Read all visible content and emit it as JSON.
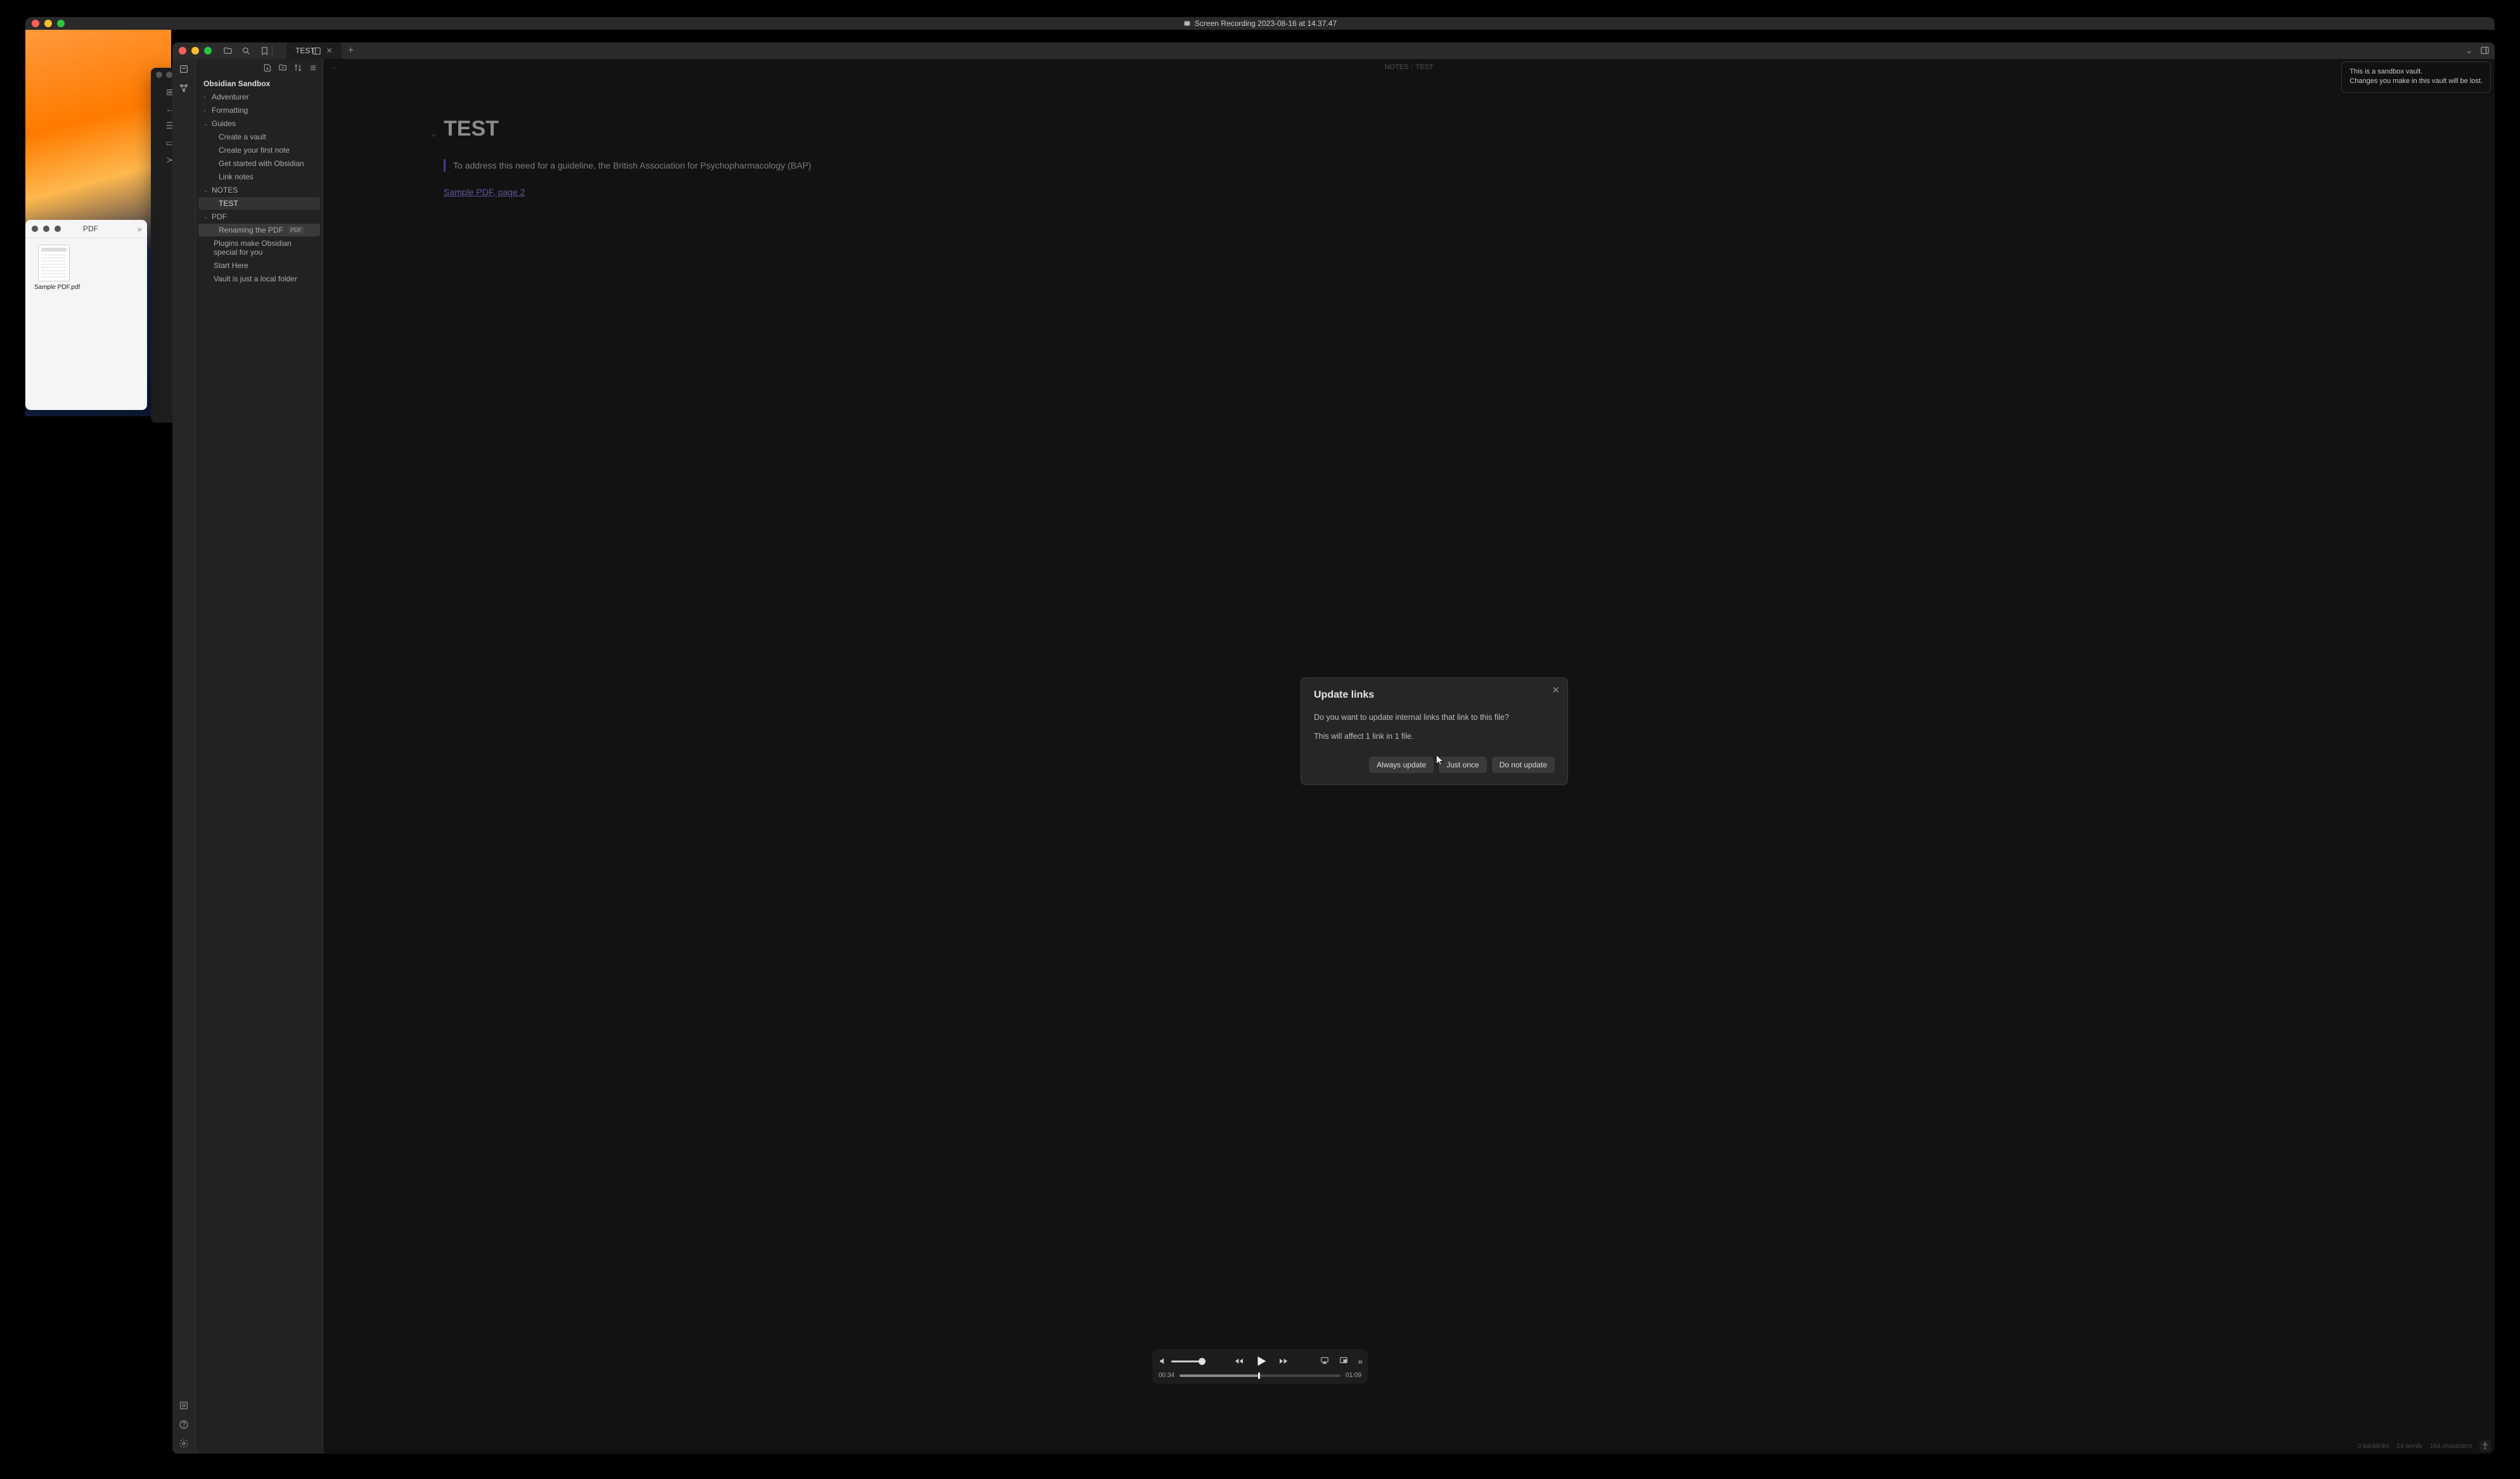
{
  "qt": {
    "title": "Screen Recording 2023-08-16 at 14.37.47",
    "controls": {
      "current": "00:34",
      "total": "01:09",
      "volume_pct": 95,
      "progress_pct": 49
    }
  },
  "finder": {
    "title": "PDF",
    "file": "Sample PDF.pdf"
  },
  "obsidian": {
    "tab": "TEST",
    "vault": "Obsidian Sandbox",
    "toast_l1": "This is a sandbox vault.",
    "toast_l2": "Changes you make in this vault will be lost.",
    "tree": {
      "adventurer": "Adventurer",
      "formatting": "Formatting",
      "guides": "Guides",
      "g1": "Create a vault",
      "g2": "Create your first note",
      "g3": "Get started with Obsidian",
      "g4": "Link notes",
      "notes": "NOTES",
      "n1": "TEST",
      "pdf": "PDF",
      "p1": "Renaming the PDF",
      "p1_badge": "PDF",
      "plugins": "Plugins make Obsidian special for you",
      "start": "Start Here",
      "vaultnote": "Vault is just a local folder"
    },
    "crumbs": {
      "a": "NOTES",
      "b": "TEST"
    },
    "note": {
      "title": "TEST",
      "quote": "To address this need for a guideline, the British Association for Psychopharmacology (BAP)",
      "link": "Sample PDF, page 2"
    },
    "modal": {
      "title": "Update links",
      "line1": "Do you want to update internal links that link to this file?",
      "line2": "This will affect 1 link in 1 file.",
      "btn_always": "Always update",
      "btn_once": "Just once",
      "btn_no": "Do not update"
    },
    "status": {
      "backlinks": "0 backlinks",
      "words": "24 words",
      "chars": "164 characters"
    }
  }
}
